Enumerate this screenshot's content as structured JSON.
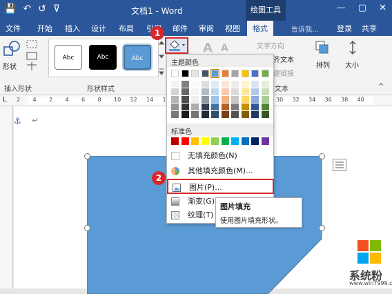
{
  "window": {
    "title": "文档1 - Word",
    "context_tab": "绘图工具",
    "minimize": "—",
    "restore": "▢",
    "close": "✕"
  },
  "qat": {
    "save": "💾",
    "undo": "↶",
    "redo": "↺",
    "more": "⊽"
  },
  "tabs": [
    "文件",
    "开始",
    "插入",
    "设计",
    "布局",
    "引用",
    "邮件",
    "审阅",
    "视图",
    "格式"
  ],
  "active_tab": "格式",
  "tell_me": "告诉我...",
  "login": "登录",
  "share": "共享",
  "ribbon": {
    "insert_shapes_label": "插入形状",
    "shape_label": "形状",
    "shape_styles_label": "形状样式",
    "style_samples": [
      "Abc",
      "Abc",
      "Abc"
    ],
    "text_direction": "文字方向",
    "align_text": "齐文本",
    "create_link": "建链接",
    "text_group": "文本",
    "arrange": "排列",
    "size": "大小"
  },
  "ruler_numbers": [
    "2",
    "4",
    "2",
    "4",
    "6",
    "8",
    "10",
    "12",
    "14",
    "16",
    "18",
    "20",
    "22",
    "24",
    "26",
    "28",
    "30",
    "32",
    "34",
    "36",
    "38",
    "40"
  ],
  "fill_menu": {
    "theme_colors_label": "主题颜色",
    "standard_colors_label": "标准色",
    "no_fill": "无填充颜色(N)",
    "more_fill_colors": "其他填充颜色(M)...",
    "picture": "图片(P)...",
    "gradient": "渐变(G)",
    "texture": "纹理(T)"
  },
  "theme_colors_top": [
    "#ffffff",
    "#000000",
    "#e7e6e6",
    "#44546a",
    "#5b9bd5",
    "#ed7d31",
    "#a5a5a5",
    "#ffc000",
    "#4472c4",
    "#70ad47"
  ],
  "standard_colors": [
    "#c00000",
    "#ff0000",
    "#ffc000",
    "#ffff00",
    "#92d050",
    "#00b050",
    "#00b0f0",
    "#0070c0",
    "#002060",
    "#7030a0"
  ],
  "tooltip": {
    "title": "图片填充",
    "body": "使用图片填充形状。"
  },
  "badges": [
    "1",
    "2"
  ],
  "shape_color": "#5b9bd5",
  "watermark": {
    "brand": "系统粉",
    "url": "www.win7999.com"
  }
}
